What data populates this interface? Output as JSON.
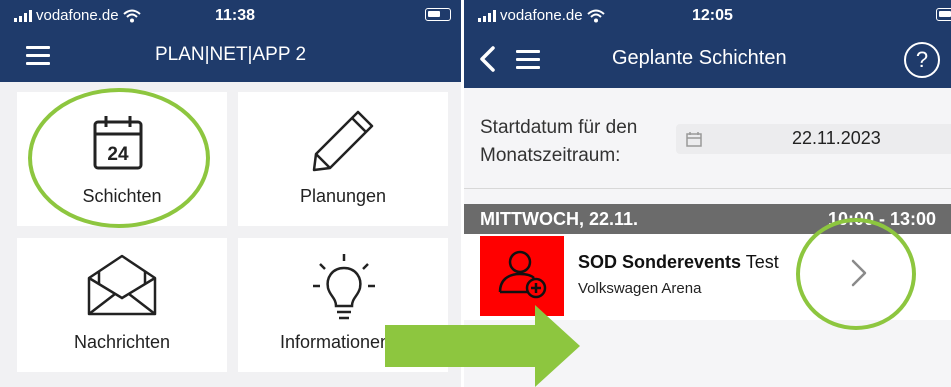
{
  "left_screen": {
    "status": {
      "carrier": "vodafone.de",
      "time": "11:38"
    },
    "app_title": "PLAN|NET|APP 2",
    "tiles": [
      {
        "label": "Schichten",
        "icon": "calendar-icon",
        "icon_text": "24"
      },
      {
        "label": "Planungen",
        "icon": "pencil-icon"
      },
      {
        "label": "Nachrichten",
        "icon": "envelope-icon"
      },
      {
        "label": "Informationen",
        "icon": "lightbulb-icon"
      }
    ]
  },
  "right_screen": {
    "status": {
      "carrier": "vodafone.de",
      "time": "12:05"
    },
    "title": "Geplante Schichten",
    "help_label": "?",
    "start_date_label": "Startdatum für den Monatszeitraum:",
    "start_date_value": "22.11.2023",
    "day_header": {
      "day": "MITTWOCH, 22.11.",
      "time_range": "10:00 - 13:00"
    },
    "shift": {
      "title_bold": "SOD Sonderevents",
      "title_rest": "Test",
      "location": "Volkswagen Arena"
    }
  },
  "colors": {
    "navbar": "#1f3b6b",
    "annotation_green": "#8dc63f",
    "shift_icon_red": "#ff0000",
    "section_header_gray": "#6b6b6b"
  }
}
